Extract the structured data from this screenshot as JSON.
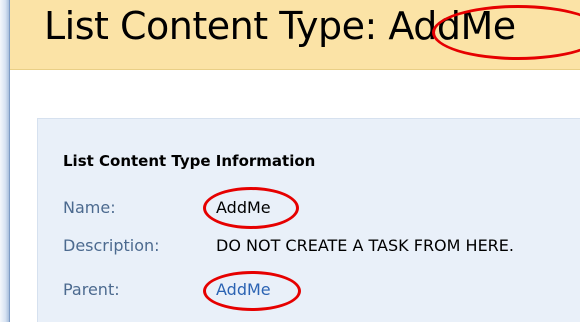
{
  "header": {
    "title": "List Content Type: AddMe"
  },
  "info": {
    "heading": "List Content Type Information",
    "rows": [
      {
        "label": "Name:",
        "value": "AddMe"
      },
      {
        "label": "Description:",
        "value": "DO NOT CREATE A TASK FROM HERE."
      },
      {
        "label": "Parent:",
        "value": "AddMe"
      }
    ]
  },
  "colors": {
    "title_band": "#fbe3a6",
    "panel_background": "#e9f0f9",
    "label_text": "#4c6a8f",
    "link_text": "#2b63b3",
    "annotation_circle": "#e60000"
  }
}
